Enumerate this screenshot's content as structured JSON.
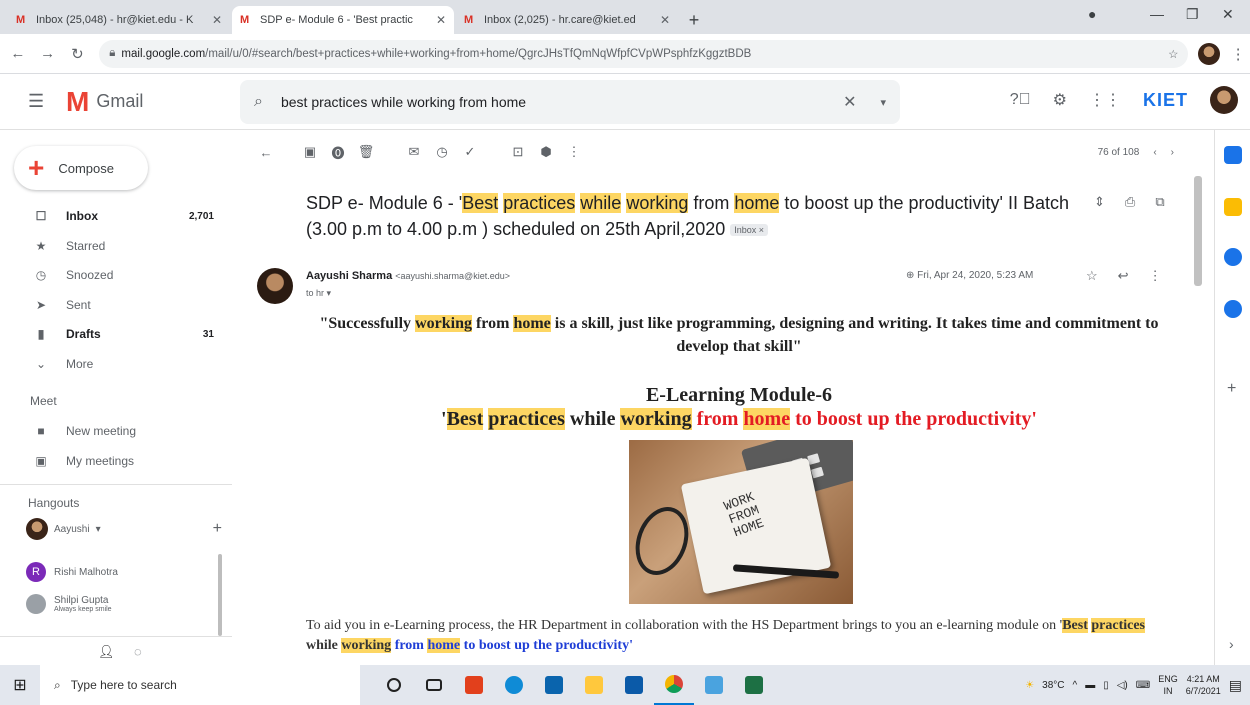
{
  "browser": {
    "tabs": [
      {
        "title": "Inbox (25,048) - hr@kiet.edu - K",
        "active": false
      },
      {
        "title": "SDP e- Module 6 - 'Best practic",
        "active": true
      },
      {
        "title": "Inbox (2,025) - hr.care@kiet.ed",
        "active": false
      }
    ],
    "new_tab_label": "+",
    "url_host": "mail.google.com",
    "url_path": "/mail/u/0/#search/best+practices+while+working+from+home/QgrcJHsTfQmNqWfpfCVpWPsphfzKggztBDB"
  },
  "gmail": {
    "logo_word": "Gmail",
    "search_query": "best practices while working from home",
    "brand": "KIET",
    "compose_label": "Compose",
    "nav": [
      {
        "label": "Inbox",
        "count": "2,701",
        "icon": "inbox-icon",
        "glyph": "☐",
        "bold": true
      },
      {
        "label": "Starred",
        "count": "",
        "icon": "star-icon",
        "glyph": "★",
        "bold": false
      },
      {
        "label": "Snoozed",
        "count": "",
        "icon": "clock-icon",
        "glyph": "◷",
        "bold": false
      },
      {
        "label": "Sent",
        "count": "",
        "icon": "send-icon",
        "glyph": "➤",
        "bold": false
      },
      {
        "label": "Drafts",
        "count": "31",
        "icon": "draft-icon",
        "glyph": "▮",
        "bold": true
      },
      {
        "label": "More",
        "count": "",
        "icon": "chevron-down-icon",
        "glyph": "⌄",
        "bold": false
      }
    ],
    "meet_header": "Meet",
    "meet_items": [
      {
        "label": "New meeting",
        "icon": "video-icon"
      },
      {
        "label": "My meetings",
        "icon": "calendar-icon"
      }
    ],
    "hangouts_header": "Hangouts",
    "hangouts_user": "Aayushi",
    "contacts": [
      {
        "name": "Rishi Malhotra",
        "initial": "R",
        "color": "#7b2ab8",
        "status": ""
      },
      {
        "name": "Shilpi Gupta",
        "initial": "",
        "color": "#9aa0a6",
        "status": "Always keep smile"
      }
    ],
    "pager": "76 of 108"
  },
  "email": {
    "subject_parts": {
      "p1": "SDP e- Module 6 - '",
      "h1": "Best",
      "s1": " ",
      "h2": "practices",
      "s2": " ",
      "h3": "while",
      "s3": " ",
      "h4": "working",
      "p2": " from ",
      "h5": "home",
      "p3": " to boost up the productivity' II Batch (3.00 p.m to 4.00 p.m ) scheduled on 25th April,2020 "
    },
    "label_chip": "Inbox ×",
    "sender_name": "Aayushi Sharma",
    "sender_email": "<aayushi.sharma@kiet.edu>",
    "to_line": "to hr ▾",
    "date": "Fri, Apr 24, 2020, 5:23 AM",
    "quote": {
      "a": "\"Successfully ",
      "b": "working",
      "c": " from ",
      "d": "home",
      "e": " is a skill, just like programming, designing and writing. It takes time and commitment to develop that skill\""
    },
    "module_title": "E-Learning Module-6",
    "module_sub": {
      "q": "'",
      "h1": "Best",
      "s1": " ",
      "h2": "practices",
      "p1": " while ",
      "h3": "working",
      "r1": " from ",
      "h4": "home",
      "r2": " to boost up the productivity'"
    },
    "image_text": [
      "WORK",
      "FROM",
      "HOME"
    ],
    "para": {
      "a": "To aid you in e-Learning process, the HR Department in collaboration with the HS Department brings to you an e-learning module on '",
      "h1": "Best",
      "s1": " ",
      "h2": "practices",
      "p1": " while ",
      "h3": "working",
      "b1": " from ",
      "h4": "home",
      "b2": " to boost up the productivity'"
    }
  },
  "taskbar": {
    "search_placeholder": "Type here to search",
    "weather": "38°C",
    "lang": "ENG",
    "region": "IN",
    "time": "4:21 AM",
    "date": "6/7/2021"
  },
  "colors": {
    "highlight": "#fdd663",
    "red_text": "#e31b23",
    "blue_text": "#1f3ed6",
    "compose_plus": "#ea4335"
  }
}
